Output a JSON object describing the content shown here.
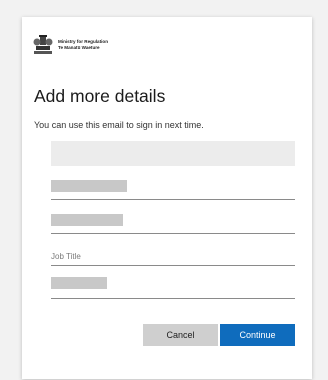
{
  "logo": {
    "line1": "Ministry for Regulation",
    "line2": "Te Manatū Waeture"
  },
  "form": {
    "title": "Add more details",
    "subtitle": "You can use this email to sign in next time.",
    "job_title_placeholder": "Job Title"
  },
  "actions": {
    "cancel": "Cancel",
    "continue": "Continue"
  },
  "colors": {
    "primary": "#0f6cbd",
    "secondary_button": "#cfcfcf"
  }
}
